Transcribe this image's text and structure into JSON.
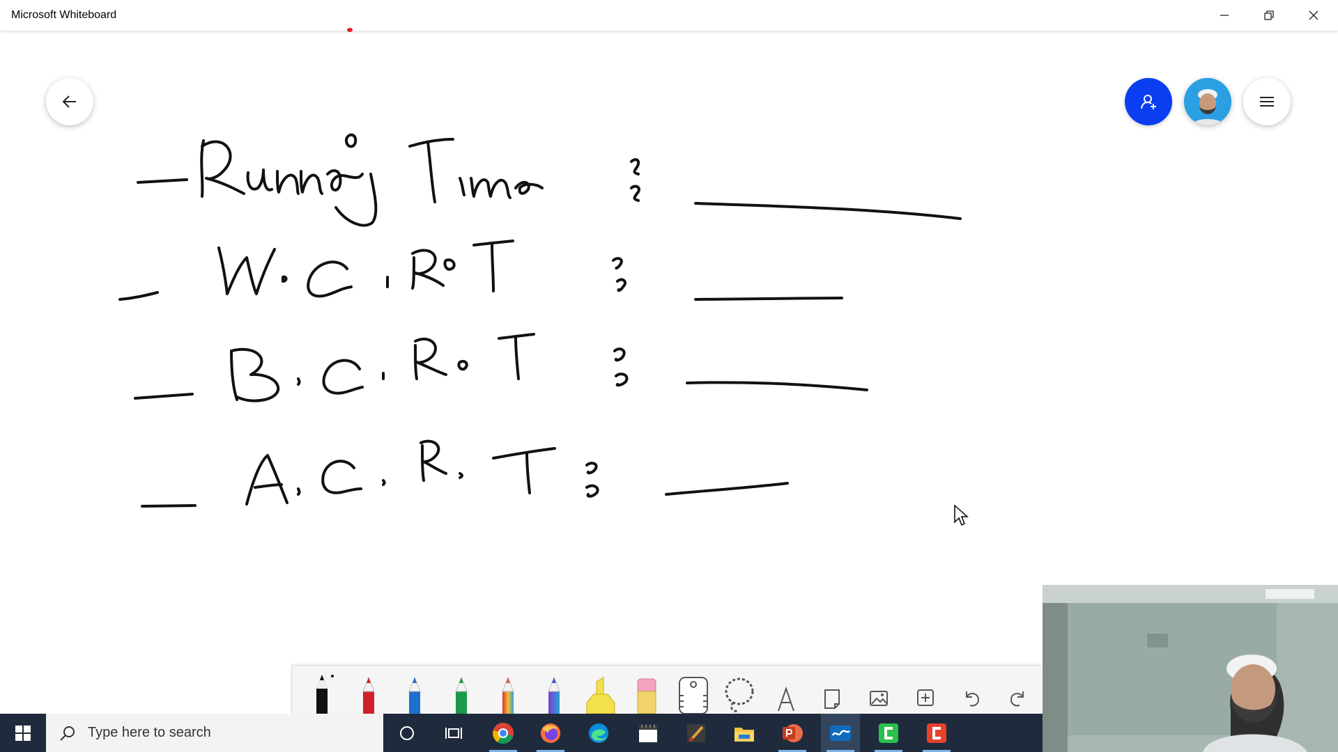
{
  "window": {
    "title": "Microsoft Whiteboard",
    "controls": [
      "minimize",
      "restore",
      "close"
    ]
  },
  "canvas": {
    "back_button_icon": "arrow-left-icon",
    "share_button_icon": "person-add-icon",
    "avatar_icon": "user-avatar",
    "menu_button_icon": "hamburger-menu-icon",
    "handwriting": [
      "Running Time :",
      "W.C.R.T :",
      "B.C.R.T :",
      "A.C.R.T :"
    ]
  },
  "toolbar": {
    "tools": [
      {
        "name": "black-pen",
        "color": "#111111"
      },
      {
        "name": "red-pen",
        "color": "#d0202a"
      },
      {
        "name": "blue-pen",
        "color": "#1f6fd1"
      },
      {
        "name": "green-pen",
        "color": "#1a9a4a"
      },
      {
        "name": "rainbow-pen",
        "color": "#e0602a"
      },
      {
        "name": "galaxy-pen",
        "color": "#3a5fc8"
      },
      {
        "name": "highlighter",
        "color": "#f4e04a"
      },
      {
        "name": "eraser",
        "color": "#f3a3c0"
      },
      {
        "name": "ruler",
        "color": "#555555"
      },
      {
        "name": "lasso-select",
        "color": "#555555"
      },
      {
        "name": "text",
        "color": "#555555"
      },
      {
        "name": "sticky-note",
        "color": "#555555"
      },
      {
        "name": "image",
        "color": "#555555"
      },
      {
        "name": "insert",
        "color": "#555555"
      },
      {
        "name": "undo",
        "color": "#555555"
      },
      {
        "name": "redo",
        "color": "#555555"
      }
    ]
  },
  "taskbar": {
    "search_placeholder": "Type here to search",
    "apps": [
      "cortana",
      "task-view",
      "chrome",
      "firefox",
      "edge",
      "calendar",
      "paint",
      "file-explorer",
      "powerpoint",
      "whiteboard",
      "camtasia-recorder",
      "camtasia"
    ],
    "active_app": "whiteboard"
  },
  "colors": {
    "share_button": "#0a3ef0",
    "taskbar": "#1f2b3c",
    "ink": "#111111"
  }
}
